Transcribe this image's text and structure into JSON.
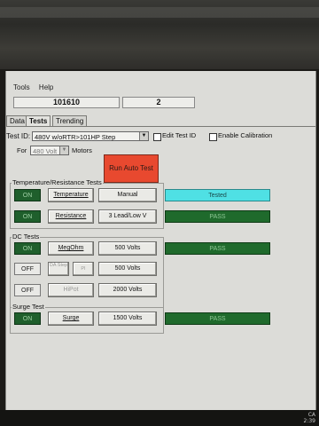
{
  "menu": {
    "items": [
      "Tools",
      "Help"
    ]
  },
  "id_row": {
    "id": "101610",
    "count": "2"
  },
  "tabs": [
    "Data",
    "Tests",
    "Trending"
  ],
  "test_id": {
    "label": "Test ID:",
    "value": "480V w/oRTR>101HP Step",
    "edit_label": "Edit Test ID",
    "enable_cal_label": "Enable Calibration"
  },
  "for_row": {
    "label": "For",
    "value": "480 Volt",
    "suffix": "Motors"
  },
  "run_auto_test": "Run Auto Test",
  "groups": {
    "temp_res": "Temperature/Resistance Tests",
    "dc": "DC Tests",
    "surge": "Surge Test"
  },
  "rows": {
    "temperature": {
      "state": "ON",
      "test": "Temperature",
      "mode": "Manual",
      "result": "Tested"
    },
    "resistance": {
      "state": "ON",
      "test": "Resistance",
      "mode": "3 Lead/Low V",
      "result": "PASS"
    },
    "megohm": {
      "state": "ON",
      "test": "MegOhm",
      "mode": "500 Volts",
      "result": "PASS"
    },
    "da_pi": {
      "state": "OFF",
      "test1": "DA Step",
      "test2": "PI",
      "mode": "500 Volts"
    },
    "hipot": {
      "state": "OFF",
      "test": "HiPot",
      "mode": "2000 Volts"
    },
    "surge": {
      "state": "ON",
      "test": "Surge",
      "mode": "1500 Volts",
      "result": "PASS"
    }
  },
  "tray": {
    "line1": "CA",
    "line2": "2:39"
  },
  "colors": {
    "on_green": "#1f5f2c",
    "pass_green": "#1f6a2c",
    "tested_cyan": "#4fe0e4",
    "run_red": "#e8492f"
  }
}
